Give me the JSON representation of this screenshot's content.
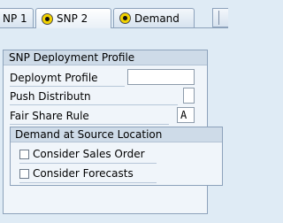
{
  "tabs": [
    {
      "label": "NP 1"
    },
    {
      "label": "SNP 2"
    },
    {
      "label": "Demand"
    }
  ],
  "group": {
    "title": "SNP Deployment Profile",
    "fields": [
      {
        "label": "Deploymt Profile",
        "value": ""
      },
      {
        "label": "Push Distributn",
        "value": ""
      },
      {
        "label": "Fair Share Rule",
        "value": "A"
      }
    ]
  },
  "subgroup": {
    "title": "Demand at Source Location",
    "checkboxes": [
      {
        "label": "Consider Sales Order",
        "checked": false
      },
      {
        "label": "Consider Forecasts",
        "checked": false
      }
    ]
  },
  "icons": {
    "tab_icon": "radio-selected-icon"
  }
}
